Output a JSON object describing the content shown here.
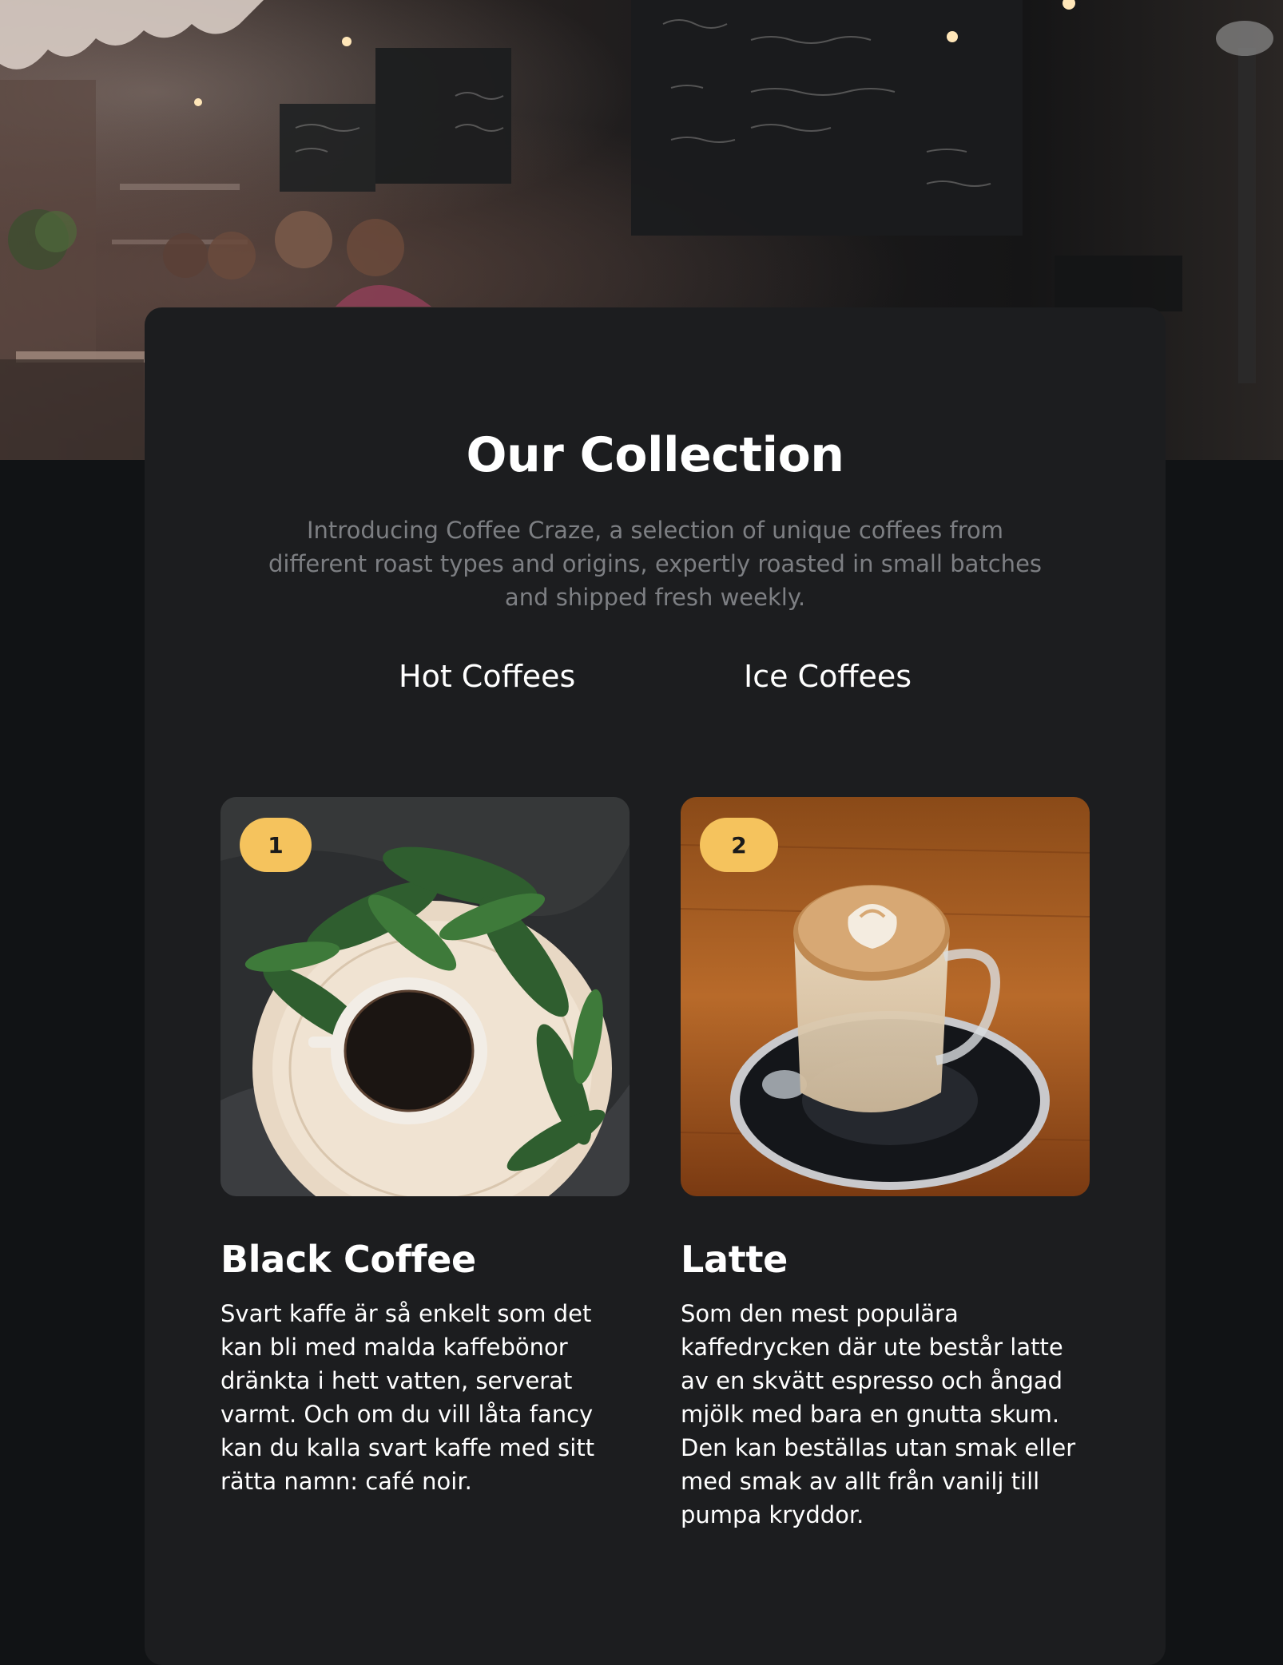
{
  "hero": {
    "image_name": "coffee-shop-storefront-image"
  },
  "collection": {
    "title": "Our Collection",
    "intro": "Introducing Coffee Craze, a selection of unique coffees from different roast types and origins, expertly roasted in small batches and shipped fresh weekly.",
    "tabs": [
      {
        "label": "Hot Coffees"
      },
      {
        "label": "Ice Coffees"
      }
    ],
    "cards": [
      {
        "badge": "1",
        "name": "Black Coffee",
        "description": "Svart kaffe är så enkelt som det kan bli med malda kaffebönor dränkta i hett vatten, serverat varmt. Och om du vill låta fancy kan du kalla svart kaffe med sitt rätta namn: café noir."
      },
      {
        "badge": "2",
        "name": "Latte",
        "description": "Som den mest populära kaffedrycken där ute består latte av en skvätt espresso och ångad mjölk med bara en gnutta skum. Den kan beställas utan smak eller med smak av allt från vanilj till pumpa kryddor."
      }
    ]
  },
  "colors": {
    "page_background": "#111315",
    "panel_background": "#1c1d1f",
    "badge": "#f5c35d",
    "intro_text": "#7d7f83",
    "heading_text": "#ffffff"
  }
}
